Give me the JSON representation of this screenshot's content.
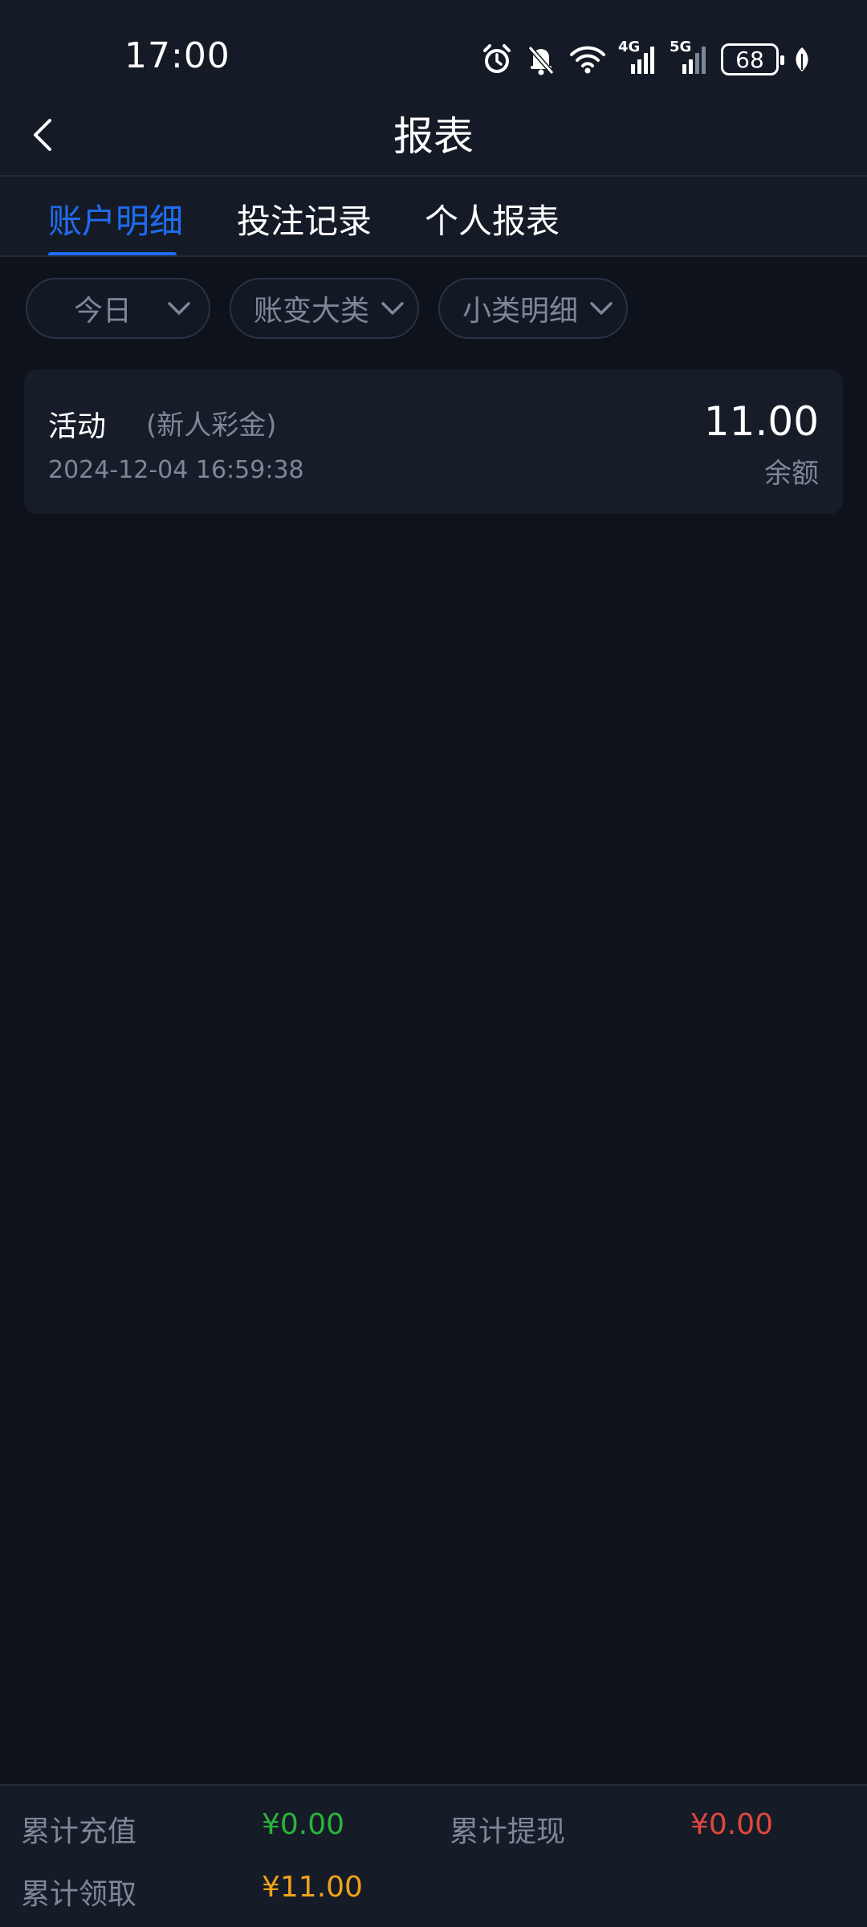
{
  "status_bar": {
    "time": "17:00",
    "network_1": "4G",
    "network_2": "5G",
    "battery": "68",
    "icons": [
      "alarm-icon",
      "bell-muted-icon",
      "wifi-icon",
      "signal-4g-icon",
      "signal-5g-icon",
      "battery-icon",
      "leaf-icon"
    ]
  },
  "header": {
    "title": "报表"
  },
  "tabs": [
    {
      "label": "账户明细",
      "active": true
    },
    {
      "label": "投注记录",
      "active": false
    },
    {
      "label": "个人报表",
      "active": false
    }
  ],
  "filters": [
    {
      "label": "今日"
    },
    {
      "label": "账变大类"
    },
    {
      "label": "小类明细"
    }
  ],
  "records": [
    {
      "type": "活动",
      "subtype": "(新人彩金)",
      "time": "2024-12-04 16:59:38",
      "amount": "11.00",
      "amount_label": "余额"
    }
  ],
  "summary": {
    "deposit_label": "累计充值",
    "deposit_value": "¥0.00",
    "withdraw_label": "累计提现",
    "withdraw_value": "¥0.00",
    "claim_label": "累计领取",
    "claim_value": "¥11.00"
  },
  "colors": {
    "accent": "#1f6cf0",
    "deposit": "#27b53a",
    "withdraw": "#e0483c",
    "claim": "#f0a21a",
    "background": "#0e121b"
  }
}
